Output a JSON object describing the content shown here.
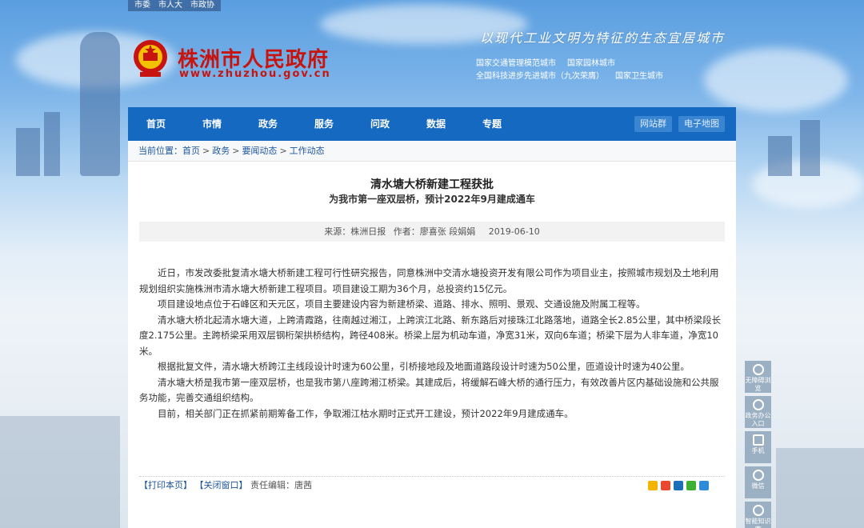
{
  "top_links": [
    "市委",
    "市人大",
    "市政协"
  ],
  "site": {
    "title": "株洲市人民政府",
    "url": "www.zhuzhou.gov.cn",
    "slogan": "以现代工业文明为特征的生态宜居城市",
    "honors": [
      "国家交通管理模范城市",
      "国家园林城市",
      "全国科技进步先进城市（九次荣膺）",
      "国家卫生城市"
    ]
  },
  "nav": {
    "items": [
      "首页",
      "市情",
      "政务",
      "服务",
      "问政",
      "数据",
      "专题"
    ],
    "right": [
      "网站群",
      "电子地图"
    ]
  },
  "breadcrumb": {
    "label": "当前位置：",
    "items": [
      "首页",
      "政务",
      "要闻动态",
      "工作动态"
    ]
  },
  "article": {
    "title": "清水塘大桥新建工程获批",
    "subtitle": "为我市第一座双层桥，预计2022年9月建成通车",
    "source": "来源：株洲日报",
    "author": "作者：廖喜张 段娟娟",
    "date": "2019-06-10",
    "paragraphs": [
      "近日，市发改委批复清水塘大桥新建工程可行性研究报告，同意株洲中交清水塘投资开发有限公司作为项目业主，按照城市规划及土地利用规划组织实施株洲市清水塘大桥新建工程项目。项目建设工期为36个月，总投资约15亿元。",
      "项目建设地点位于石峰区和天元区，项目主要建设内容为新建桥梁、道路、排水、照明、景观、交通设施及附属工程等。",
      "清水塘大桥北起清水塘大道，上跨清霞路，往南越过湘江，上跨滨江北路、新东路后对接珠江北路落地，道路全长2.85公里，其中桥梁段长度2.175公里。主跨桥梁采用双层钢桁架拱桥结构，跨径408米。桥梁上层为机动车道，净宽31米，双向6车道；桥梁下层为人非车道，净宽10米。",
      "根据批复文件，清水塘大桥跨江主线段设计时速为60公里，引桥接地段及地面道路段设计时速为50公里，匝道设计时速为40公里。",
      "清水塘大桥是我市第一座双层桥，也是我市第八座跨湘江桥梁。其建成后，将缓解石峰大桥的通行压力，有效改善片区内基础设施和公共服务功能，完善交通组织结构。",
      "目前，相关部门正在抓紧前期筹备工作，争取湘江枯水期时正式开工建设，预计2022年9月建成通车。"
    ]
  },
  "footer": {
    "print": "【打印本页】",
    "close": "【关闭窗口】",
    "editor": "责任编辑：唐茜"
  },
  "side_float": [
    "无障碍浏览",
    "政务办公入口",
    "手机",
    "微信",
    "智能知识库"
  ],
  "colors": {
    "nav_bg": "#1569c1",
    "title_red": "#c8140f",
    "link_blue": "#1f57a0"
  }
}
